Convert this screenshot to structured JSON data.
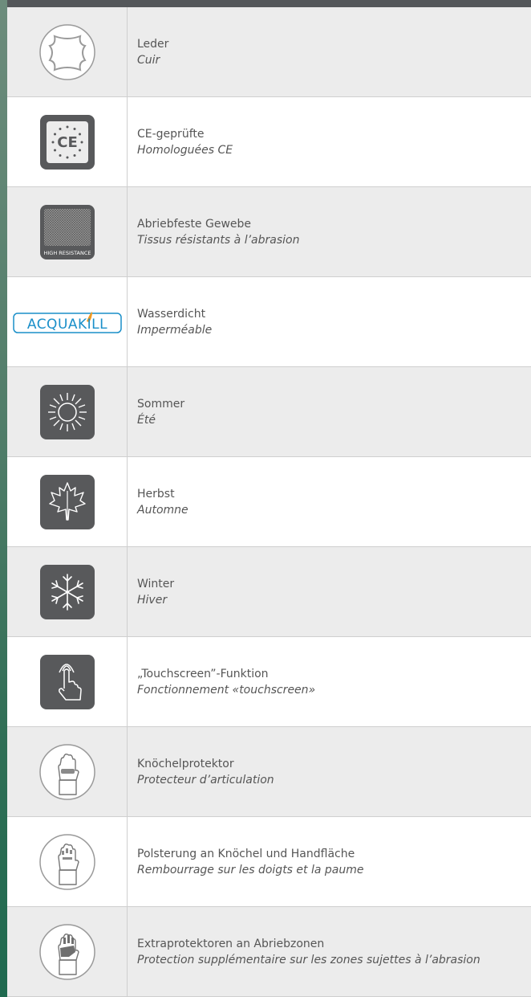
{
  "features": [
    {
      "icon": "leather-icon",
      "de": "Leder",
      "fr": "Cuir"
    },
    {
      "icon": "ce-certification-icon",
      "de": "CE-geprüfte",
      "fr": "Homologuées CE"
    },
    {
      "icon": "high-resistance-fabric-icon",
      "de": "Abriebfeste Gewebe",
      "fr": "Tissus résistants à l’abrasion",
      "icon_label": "HIGH RESISTANCE"
    },
    {
      "icon": "acquakill-logo",
      "de": "Wasserdicht",
      "fr": "Imperméable",
      "icon_label": "ACQUAKILL"
    },
    {
      "icon": "sun-icon",
      "de": "Sommer",
      "fr": "Été"
    },
    {
      "icon": "maple-leaf-icon",
      "de": "Herbst",
      "fr": "Automne"
    },
    {
      "icon": "snowflake-icon",
      "de": "Winter",
      "fr": "Hiver"
    },
    {
      "icon": "touchscreen-icon",
      "de": "„Touchscreen”-Funktion",
      "fr": "Fonctionnement «touchscreen»"
    },
    {
      "icon": "knuckle-protector-glove-icon",
      "de": "Knöchelprotektor",
      "fr": "Protecteur d’articulation"
    },
    {
      "icon": "padded-glove-icon",
      "de": "Polsterung an Knöchel und Handfläche",
      "fr": "Rembourrage sur les doigts et la paume"
    },
    {
      "icon": "extra-protector-glove-icon",
      "de": "Extraprotektoren an Abriebzonen",
      "fr": "Protection supplémentaire sur les zones sujettes à l’abrasion"
    }
  ],
  "colors": {
    "header_bar": "#54575a",
    "row_shaded": "#ececec",
    "icon_tile": "#58595b",
    "text": "#555555",
    "acquakill_blue": "#1a8fc9",
    "acquakill_orange": "#f29a1f"
  }
}
